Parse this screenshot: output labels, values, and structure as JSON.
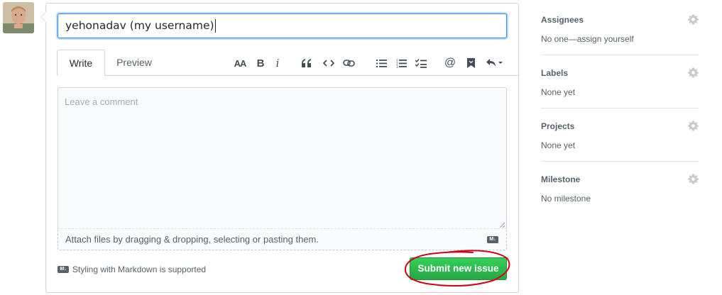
{
  "issue": {
    "title_value": "yehonadav (my username)",
    "tabs": [
      "Write",
      "Preview"
    ],
    "comment_placeholder": "Leave a comment",
    "attach_text": "Attach files by dragging & dropping, selecting or pasting them.",
    "markdown_badge": "M↓",
    "markdown_note": "Styling with Markdown is supported",
    "submit_label": "Submit new issue"
  },
  "toolbar": {
    "icons": [
      "text-size-icon",
      "bold-icon",
      "italic-icon",
      "quote-icon",
      "code-icon",
      "link-icon",
      "bulleted-list-icon",
      "numbered-list-icon",
      "task-list-icon",
      "mention-icon",
      "saved-reply-icon",
      "reply-icon"
    ],
    "heading_label": "AA",
    "bold_label": "B",
    "italic_label": "i",
    "mention_label": "@"
  },
  "sidebar": {
    "sections": [
      {
        "heading": "Assignees",
        "value": "No one—assign yourself"
      },
      {
        "heading": "Labels",
        "value": "None yet"
      },
      {
        "heading": "Projects",
        "value": "None yet"
      },
      {
        "heading": "Milestone",
        "value": "No milestone"
      }
    ]
  },
  "colors": {
    "accent_blue": "#2188ff",
    "submit_green": "#28a745",
    "annotation_red": "#d0021b",
    "muted_text": "#586069"
  }
}
